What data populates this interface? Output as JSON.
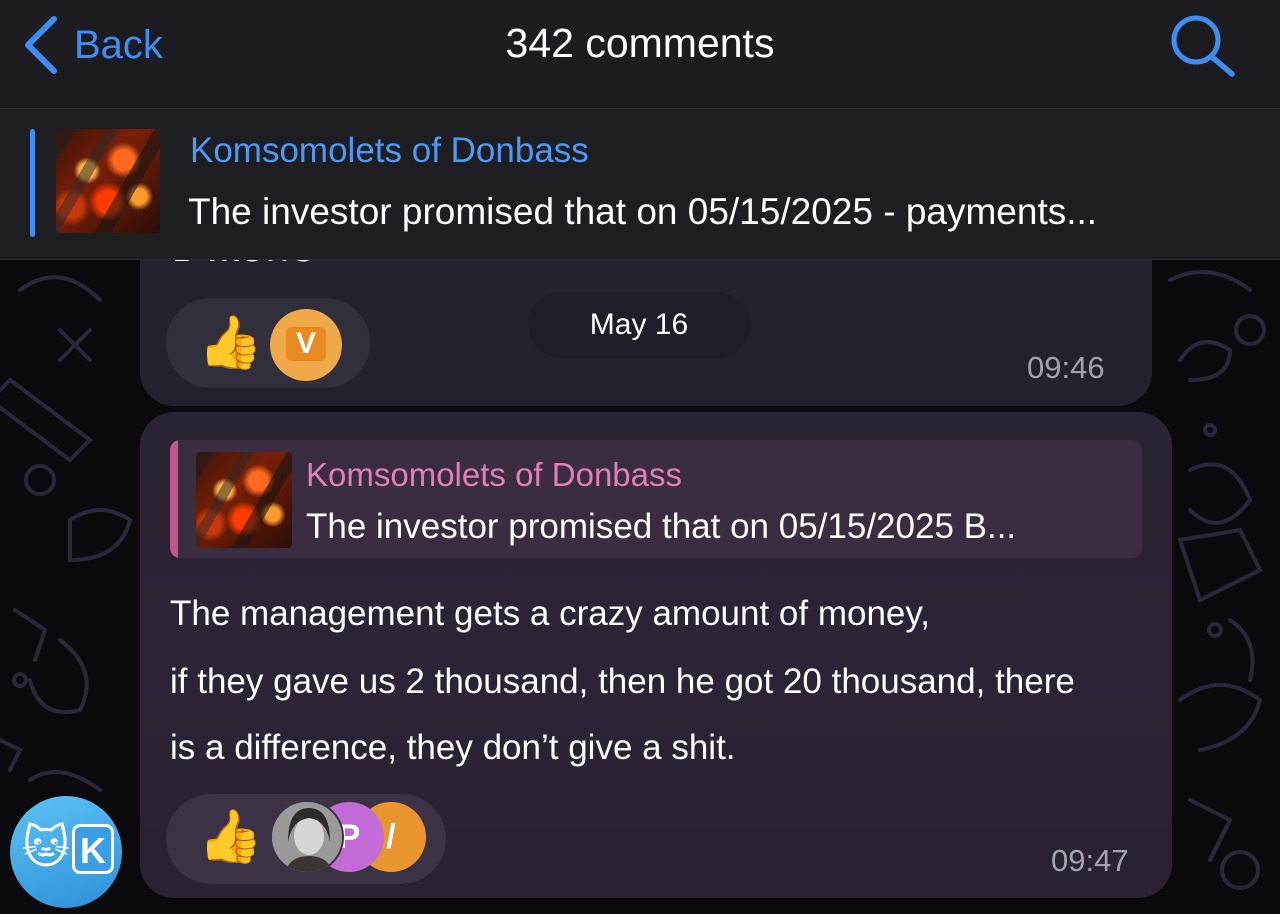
{
  "nav": {
    "back_label": "Back",
    "title": "342 comments",
    "accent_color": "#3d8df5"
  },
  "pinned": {
    "channel_name": "Komsomolets of Donbass",
    "preview": "The investor promised that on 05/15/2025 - payments..."
  },
  "message1": {
    "cut_text": "в жопе",
    "reactions": [
      "thumbs-up",
      "avatar-v"
    ],
    "avatar_letter": "V",
    "time": "09:46"
  },
  "date_divider": "May 16",
  "message2": {
    "reply_name": "Komsomolets of Donbass",
    "reply_text": "The investor promised that on 05/15/2025 В...",
    "lines": [
      "The management gets a crazy amount of money,",
      "if they gave us 2 thousand, then he got 20 thousand, there",
      "is a difference, they don’t give a shit."
    ],
    "reaction_avatars": [
      "photo",
      "P",
      "/"
    ],
    "time": "09:47"
  },
  "sender": {
    "avatar_letter": "K"
  }
}
